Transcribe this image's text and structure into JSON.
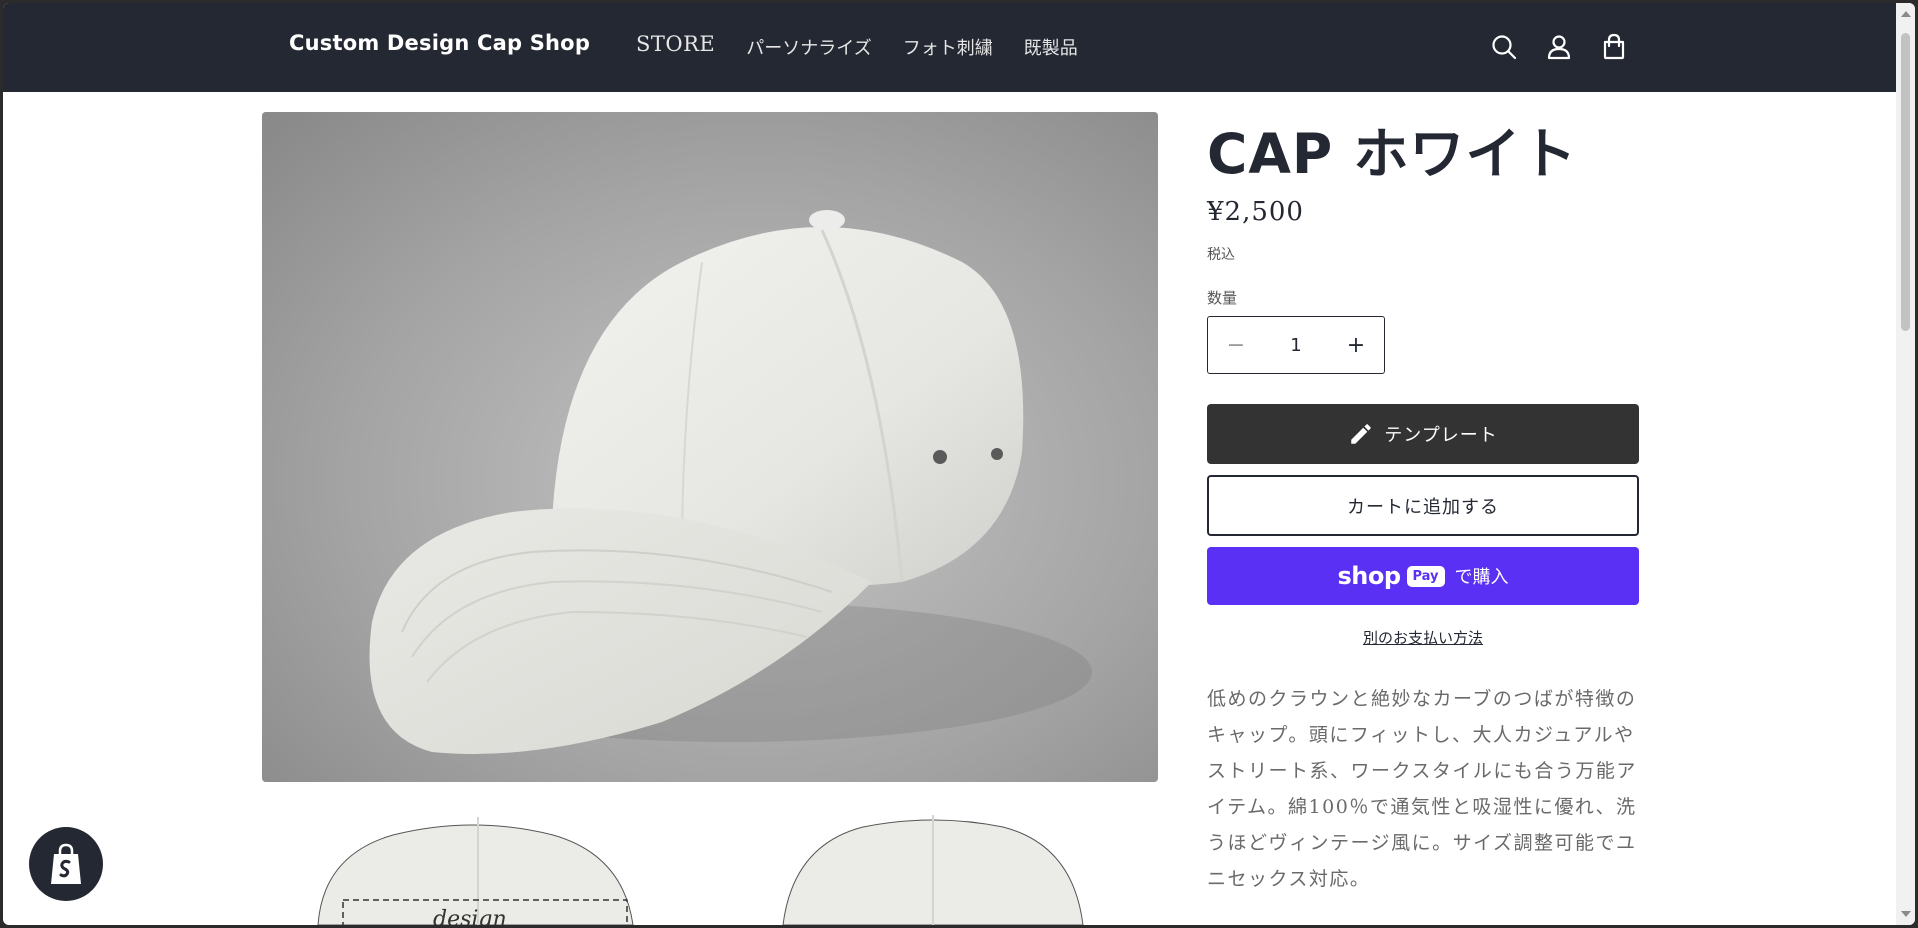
{
  "header": {
    "logo": "Custom Design Cap Shop",
    "nav": [
      {
        "label": "STORE"
      },
      {
        "label": "パーソナライズ"
      },
      {
        "label": "フォト刺繍"
      },
      {
        "label": "既製品"
      }
    ],
    "icons": [
      "search-icon",
      "account-icon",
      "cart-icon"
    ]
  },
  "product": {
    "title": "CAP ホワイト",
    "price": "¥2,500",
    "tax_note": "税込",
    "quantity_label": "数量",
    "quantity_value": "1",
    "decrease_symbol": "−",
    "increase_symbol": "+",
    "template_button": "テンプレート",
    "add_to_cart_button": "カートに追加する",
    "shoppay": {
      "shop": "shop",
      "pay": "Pay",
      "suffix": "で購入"
    },
    "other_payment_link": "別のお支払い方法",
    "description": "低めのクラウンと絶妙なカーブのつばが特徴のキャップ。頭にフィットし、大人カジュアルやストリート系、ワークスタイルにも合う万能アイテム。綿100％で通気性と吸湿性に優れ、洗うほどヴィンテージ風に。サイズ調整可能でユニセックス対応。"
  },
  "thumbnail": {
    "overlay_text": "design"
  },
  "colors": {
    "header_bg": "#242833",
    "template_button_bg": "#333333",
    "shoppay_bg": "#5a31f4",
    "text_dark": "#242833",
    "text_muted": "#6a6a6a"
  }
}
